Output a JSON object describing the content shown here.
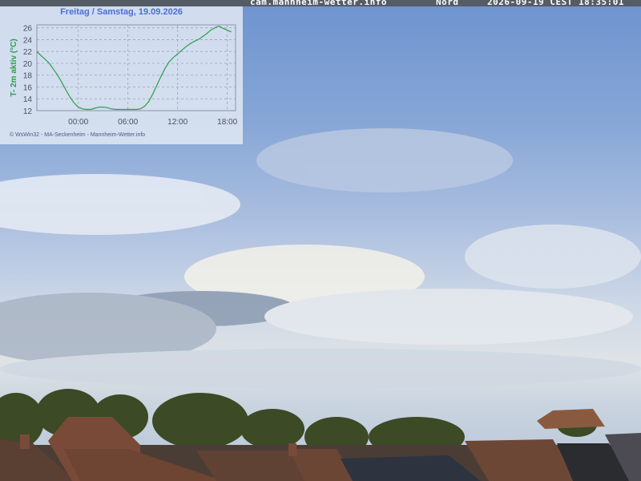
{
  "camera": {
    "site": "cam.mannheim-wetter.info",
    "direction": "Nord",
    "timestamp": "2026-09-19 CEST 18:35:01"
  },
  "overlay": {
    "title": "Freitag / Samstag, 19.09.2026",
    "footer": "© WsWin32 - MA-Seckenheim - Mannheim-Wetter.info"
  },
  "chart_data": {
    "type": "line",
    "title": "Freitag / Samstag, 19.09.2026",
    "ylabel": "T- 2m aktiv  (°C)",
    "xlabel": "",
    "x_ticks": [
      "00:00",
      "06:00",
      "12:00",
      "18:00"
    ],
    "y_ticks": [
      12,
      14,
      16,
      18,
      20,
      22,
      24,
      26
    ],
    "ylim": [
      12,
      26.5
    ],
    "xlim_hours": [
      -5,
      19
    ],
    "grid": true,
    "color": "#2e9e4a",
    "series": [
      {
        "x_hours": [
          -5,
          -4.5,
          -4,
          -3.5,
          -3,
          -2.5,
          -2,
          -1.5,
          -1,
          -0.5,
          0,
          0.5,
          1,
          1.5,
          2,
          2.5,
          3,
          3.5,
          4,
          4.5,
          5,
          5.5,
          6,
          6.5,
          7,
          7.5,
          8,
          8.5,
          9,
          9.5,
          10,
          10.5,
          11,
          11.5,
          12,
          12.5,
          13,
          13.5,
          14,
          14.5,
          15,
          15.5,
          16,
          16.5,
          17,
          17.5,
          18,
          18.5
        ],
        "values": [
          22.0,
          21.3,
          20.7,
          20.0,
          19.0,
          18.0,
          16.8,
          15.5,
          14.3,
          13.3,
          12.6,
          12.3,
          12.2,
          12.2,
          12.4,
          12.6,
          12.6,
          12.5,
          12.3,
          12.2,
          12.2,
          12.2,
          12.2,
          12.2,
          12.2,
          12.3,
          12.7,
          13.5,
          14.8,
          16.3,
          17.8,
          19.2,
          20.3,
          21.0,
          21.6,
          22.2,
          22.8,
          23.3,
          23.7,
          24.0,
          24.5,
          25.0,
          25.6,
          26.0,
          26.3,
          25.9,
          25.6,
          25.3
        ]
      }
    ]
  }
}
